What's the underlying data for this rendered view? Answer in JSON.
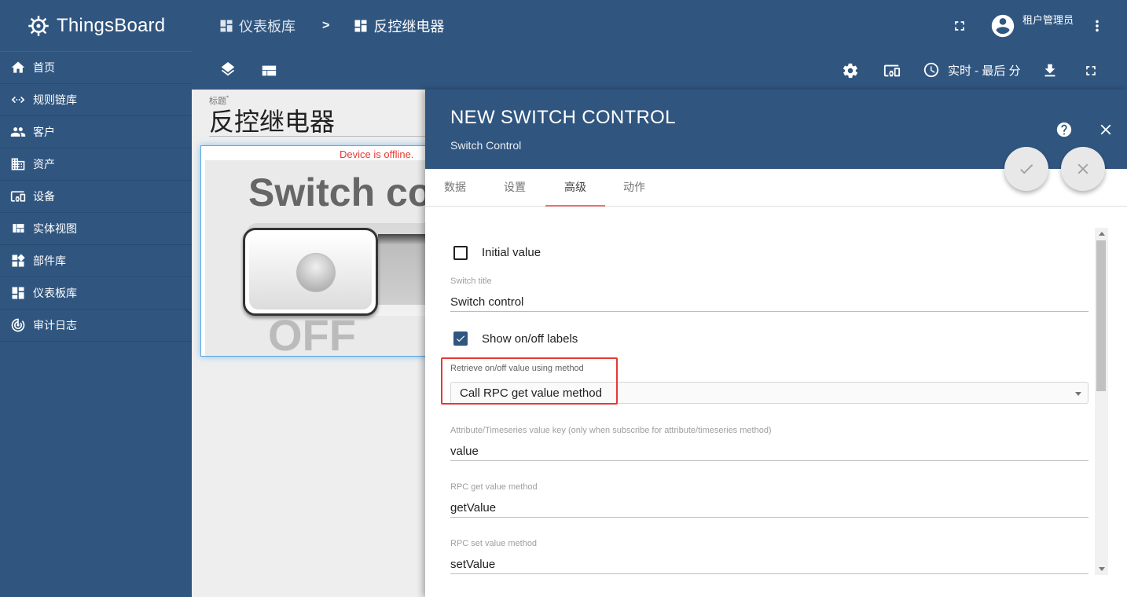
{
  "sidebar": {
    "brand": "ThingsBoard",
    "items": [
      {
        "label": "首页",
        "icon": "home-icon"
      },
      {
        "label": "规则链库",
        "icon": "code-arrows-icon"
      },
      {
        "label": "客户",
        "icon": "people-icon"
      },
      {
        "label": "资产",
        "icon": "domain-icon"
      },
      {
        "label": "设备",
        "icon": "devices-icon"
      },
      {
        "label": "实体视图",
        "icon": "view-quilt-icon"
      },
      {
        "label": "部件库",
        "icon": "widgets-icon"
      },
      {
        "label": "仪表板库",
        "icon": "dashboard-icon"
      },
      {
        "label": "审计日志",
        "icon": "track-changes-icon"
      }
    ]
  },
  "header": {
    "breadcrumb": [
      {
        "label": "仪表板库",
        "icon": "dashboard-icon"
      },
      {
        "label": "反控继电器",
        "icon": "dashboard-icon"
      }
    ],
    "breadcrumb_separator": ">",
    "user_name": "租户管理员"
  },
  "toolbar": {
    "realtime_label": "实时 - 最后 分"
  },
  "dashboard": {
    "title_label": "标题",
    "title": "反控继电器",
    "widget": {
      "offline_text": "Device is offline.",
      "title": "Switch co",
      "state_label": "OFF"
    }
  },
  "dialog": {
    "title": "NEW SWITCH CONTROL",
    "subtitle": "Switch Control",
    "tabs": [
      "数据",
      "设置",
      "高级",
      "动作"
    ],
    "active_tab": "高级",
    "fields": {
      "initial_value_label": "Initial value",
      "initial_value_checked": false,
      "switch_title_label": "Switch title",
      "switch_title_value": "Switch control",
      "show_labels_label": "Show on/off labels",
      "show_labels_checked": true,
      "retrieve_label": "Retrieve on/off value using method",
      "retrieve_value": "Call RPC get value method",
      "attr_key_label": "Attribute/Timeseries value key (only when subscribe for attribute/timeseries method)",
      "attr_key_value": "value",
      "rpc_get_label": "RPC get value method",
      "rpc_get_value": "getValue",
      "rpc_set_label": "RPC set value method",
      "rpc_set_value": "setValue"
    }
  },
  "colors": {
    "primary": "#305680",
    "accent": "#e57373",
    "offline": "#e53935"
  }
}
